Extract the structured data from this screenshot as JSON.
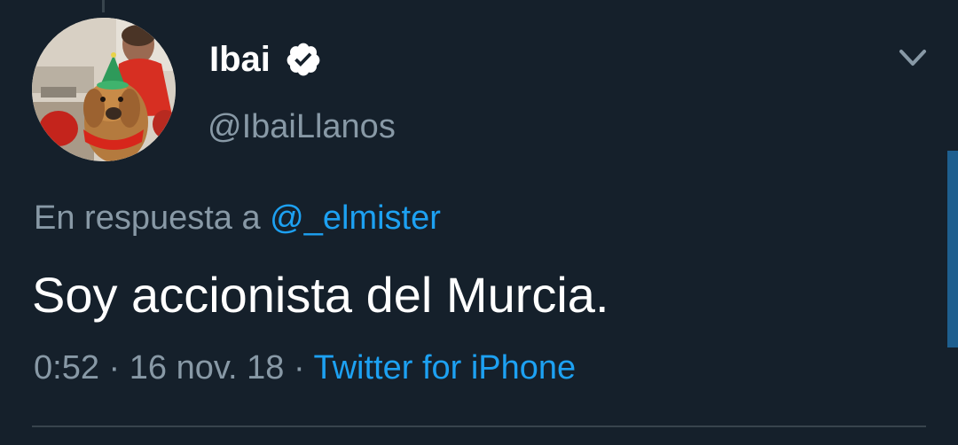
{
  "tweet": {
    "author": {
      "display_name": "Ibai",
      "handle": "@IbaiLlanos",
      "verified": true,
      "avatar_icon": "profile-photo"
    },
    "reply_prefix": "En respuesta a",
    "reply_to": "@_elmister",
    "text": "Soy accionista del Murcia.",
    "time": "0:52",
    "separator": "·",
    "date": "16 nov. 18",
    "source": "Twitter for iPhone",
    "menu_icon": "chevron-down-icon"
  },
  "colors": {
    "background": "#15202b",
    "primary_text": "#ffffff",
    "secondary_text": "#8899a6",
    "accent": "#1da1f2",
    "divider": "#38444d"
  }
}
